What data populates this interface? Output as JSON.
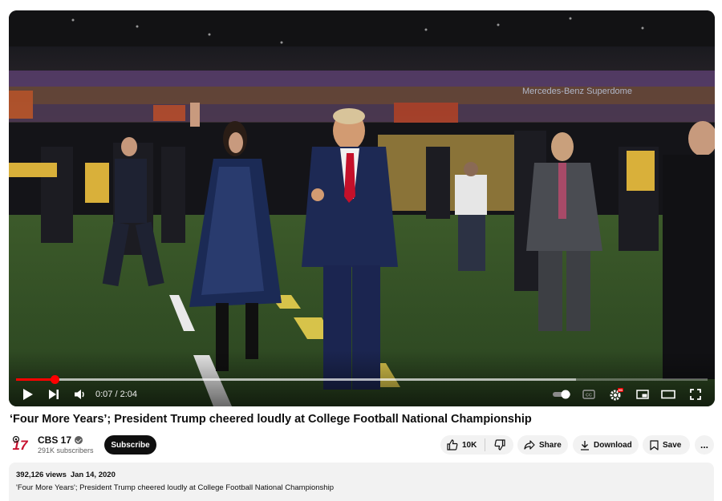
{
  "player": {
    "current_time": "0:07",
    "separator": " / ",
    "duration": "2:04",
    "progress_fraction": 0.056,
    "buffered_fraction": 0.81,
    "accent": "#ff0000",
    "venue_sign": "Mercedes-Benz Superdome",
    "icons": [
      "play-icon",
      "next-icon",
      "volume-icon",
      "autoplay-toggle-icon",
      "captions-icon",
      "settings-icon",
      "miniplayer-icon",
      "theater-icon",
      "fullscreen-icon"
    ],
    "settings_badge": "HD"
  },
  "video": {
    "title": "‘Four More Years’; President Trump cheered loudly at College Football National Championship"
  },
  "channel": {
    "name": "CBS 17",
    "subscribers": "291K subscribers",
    "logo_text": "17",
    "subscribe_label": "Subscribe"
  },
  "actions": {
    "likes": "10K",
    "share_label": "Share",
    "download_label": "Download",
    "save_label": "Save",
    "more_label": "..."
  },
  "description": {
    "views": "392,126 views",
    "date": "Jan 14, 2020",
    "text": "'Four More Years'; President Trump cheered loudly at College Football National Championship"
  }
}
